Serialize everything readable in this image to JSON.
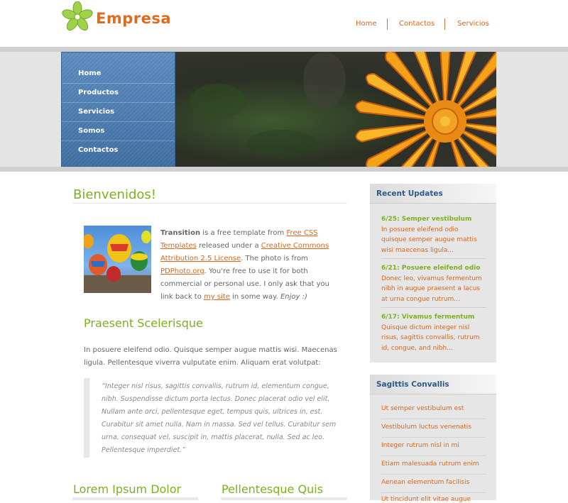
{
  "brand": {
    "name": "Empresa",
    "logo_icon": "flower-icon",
    "color": "#e06b1f"
  },
  "top_nav": [
    "Home",
    "Contactos",
    "Servicios"
  ],
  "side_nav": [
    "Home",
    "Productos",
    "Servicios",
    "Somos",
    "Contactos"
  ],
  "main": {
    "heading": "Bienvenidos!",
    "intro": {
      "bold": "Transition",
      "t1": " is a free template from ",
      "link1": "Free CSS Templates",
      "t2": " released under a ",
      "link2": "Creative Commons Attribution 2.5 License",
      "t3": ". The photo is from ",
      "link3": "PDPhoto.org",
      "t4": ". You're free to use it for both commercial or personal use. I only ask that you link back to ",
      "link4": "my site",
      "t5": " in some way. ",
      "em": "Enjoy :)"
    },
    "subheading": "Praesent Scelerisque",
    "paragraph": "In posuere eleifend odio. Quisque semper augue mattis wisi. Maecenas ligula. Pellentesque viverra vulputate enim. Aliquam erat volutpat:",
    "quote": "“Integer nisl risus, sagittis convallis, rutrum id, elementum congue, nibh. Suspendisse dictum porta lectus. Donec placerat odio vel elit. Nullam ante orci, pellentesque eget, tempus quis, ultrices in, est. Curabitur sit amet nulla. Nam in massa. Sed vel tellus. Curabitur sem urna, consequat vel, suscipit in, mattis placerat, nulla. Sed ac leo. Pellentesque imperdiet.”",
    "bottom_left": "Lorem Ipsum Dolor",
    "bottom_right": "Pellentesque Quis"
  },
  "sidebar": {
    "updates_title": "Recent Updates",
    "updates": [
      {
        "title": "6/25: Semper vestibulum",
        "body": "In posuere eleifend odio quisque semper augue mattis wisi maecenas ligula..."
      },
      {
        "title": "6/21: Posuere eleifend odio",
        "body": "Donec leo, vivamus fermentum nibh in augue praesent a lacus at urna congue rutrum..."
      },
      {
        "title": "6/17: Vivamus fermentum",
        "body": "Quisque dictum integer nisl risus, sagittis convallis, rutrum id, congue, and nibh..."
      }
    ],
    "links_title": "Sagittis Convallis",
    "links": [
      "Ut semper vestibulum est",
      "Vestibulum luctus venenatis",
      "Integer rutrum nisl in mi",
      "Etiam malesuada rutrum enim",
      "Aenean elementum facilisis",
      "Ut tincidunt elit vitae augue"
    ]
  }
}
